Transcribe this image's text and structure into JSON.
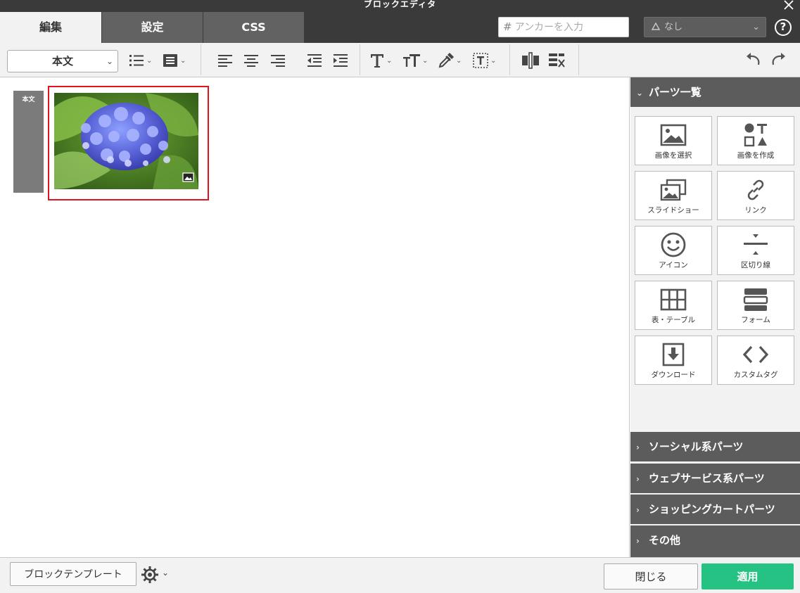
{
  "window": {
    "title": "ブロックエディタ"
  },
  "tabs": [
    {
      "label": "編集",
      "active": true
    },
    {
      "label": "設定",
      "active": false
    },
    {
      "label": "CSS",
      "active": false
    }
  ],
  "anchor": {
    "placeholder": "アンカーを入力"
  },
  "class_select": {
    "value": "なし"
  },
  "toolbar": {
    "style_value": "本文"
  },
  "canvas": {
    "block_label": "本文"
  },
  "sidebar": {
    "parts_title": "パーツ一覧",
    "parts": [
      {
        "label": "画像を選択",
        "icon": "image-select-icon"
      },
      {
        "label": "画像を作成",
        "icon": "shapes-icon"
      },
      {
        "label": "スライドショー",
        "icon": "slideshow-icon"
      },
      {
        "label": "リンク",
        "icon": "link-icon"
      },
      {
        "label": "アイコン",
        "icon": "smiley-icon"
      },
      {
        "label": "区切り線",
        "icon": "divider-icon"
      },
      {
        "label": "表・テーブル",
        "icon": "table-icon"
      },
      {
        "label": "フォーム",
        "icon": "form-icon"
      },
      {
        "label": "ダウンロード",
        "icon": "download-icon"
      },
      {
        "label": "カスタムタグ",
        "icon": "code-icon"
      }
    ],
    "sections": [
      "ソーシャル系パーツ",
      "ウェブサービス系パーツ",
      "ショッピングカートパーツ",
      "その他"
    ]
  },
  "bottom": {
    "template_button": "ブロックテンプレート",
    "close_button": "閉じる",
    "apply_button": "適用"
  },
  "colors": {
    "apply": "#26c283",
    "selection": "#e0141e",
    "header": "#3a3a3a"
  }
}
